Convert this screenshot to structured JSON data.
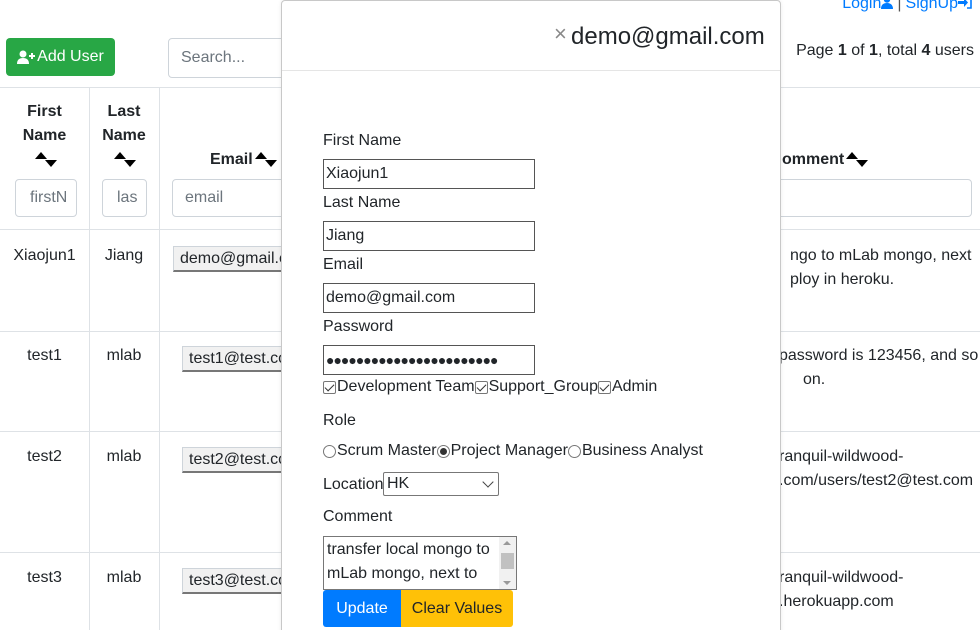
{
  "header": {
    "login": "Login",
    "separator": "|",
    "signup": "SignUp",
    "login_icon": "user-icon",
    "signup_icon": "sign-in-icon"
  },
  "toolbar": {
    "add_user": "Add User",
    "add_user_icon": "user-plus-icon",
    "search_placeholder": "Search...",
    "page_prefix": "Page ",
    "page_current": "1",
    "page_of": " of ",
    "page_total": "1",
    "total_prefix": ", total ",
    "total_count": "4",
    "total_suffix": " users"
  },
  "table": {
    "headers": {
      "first_name_1": "First",
      "first_name_2": "Name",
      "last_name_1": "Last",
      "last_name_2": "Name",
      "email": "Email",
      "comment": "omment"
    },
    "filters": {
      "first": "firstN",
      "last": "las",
      "email": "email"
    },
    "rows": [
      {
        "first": "Xiaojun1",
        "last": "Jiang",
        "email": "demo@gmail.c",
        "comment_1": "ngo to mLab mongo, next",
        "comment_2": "ploy in heroku."
      },
      {
        "first": "test1",
        "last": "mlab",
        "email": "test1@test.co",
        "comment_1": "password is 123456, and so",
        "comment_2": "on."
      },
      {
        "first": "test2",
        "last": "mlab",
        "email": "test2@test.co",
        "comment_1": "ranquil-wildwood-",
        "comment_2": ".com/users/test2@test.com"
      },
      {
        "first": "test3",
        "last": "mlab",
        "email": "test3@test.co",
        "comment_1": "ranquil-wildwood-",
        "comment_2": ".herokuapp.com"
      }
    ]
  },
  "modal": {
    "close": "×",
    "title": "demo@gmail.com",
    "first_name_label": "First Name",
    "first_name_value": "Xiaojun1",
    "last_name_label": "Last Name",
    "last_name_value": "Jiang",
    "email_label": "Email",
    "email_value": "demo@gmail.com",
    "password_label": "Password",
    "password_value": "●●●●●●●●●●●●●●●●●●●●●●●",
    "groups": [
      "Development Team",
      "Support_Group",
      "Admin"
    ],
    "role_label": "Role",
    "roles": [
      "Scrum Master",
      "Project Manager",
      "Business Analyst"
    ],
    "selected_role": "Project Manager",
    "location_label": "Location",
    "location_value": "HK",
    "comment_label": "Comment",
    "comment_value": "transfer local mongo to mLab mongo, next to",
    "update_button": "Update",
    "clear_button": "Clear Values"
  },
  "colors": {
    "add_user": "#28a745",
    "update": "#007bff",
    "clear": "#ffc107",
    "link": "#007bff"
  }
}
